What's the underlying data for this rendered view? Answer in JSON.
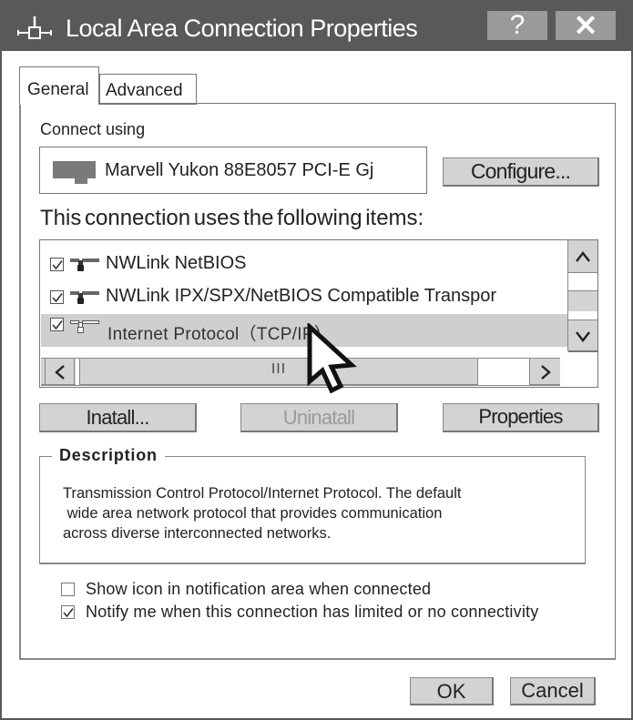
{
  "window": {
    "title": "Local Area Connection Properties",
    "help_label": "?",
    "close_label": "✕",
    "title_icon": "network-connection-icon"
  },
  "tabs": [
    {
      "label": "General",
      "active": true
    },
    {
      "label": "Advanced",
      "active": false
    }
  ],
  "connect_using": {
    "label": "Connect using",
    "adapter_name": "Marvell Yukon 88E8057 PCI-E Gj",
    "adapter_icon": "network-adapter-icon",
    "configure_label": "Configure..."
  },
  "items_section": {
    "heading": "This connection uses the following items:",
    "items": [
      {
        "label": "NWLink NetBIOS",
        "checked": true,
        "selected": false,
        "icon": "protocol-icon"
      },
      {
        "label": "NWLink IPX/SPX/NetBIOS Compatible Transpor",
        "checked": true,
        "selected": false,
        "icon": "protocol-icon"
      },
      {
        "label": "Internet Protocol（TCP/IP）",
        "checked": true,
        "selected": true,
        "icon": "protocol-icon"
      }
    ],
    "scroll_up": "^",
    "scroll_down": "v",
    "scroll_left": "<",
    "scroll_right": ">",
    "hscroll_grip": "III"
  },
  "actions": {
    "install_label": "Inatall...",
    "uninstall_label": "Uninatall",
    "uninstall_disabled": true,
    "properties_label": "Properties"
  },
  "description": {
    "legend": "Description",
    "text": "Transmission Control Protocol/Internet Protocol. The default\n wide area network protocol that provides communication\nacross diverse interconnected networks."
  },
  "options": [
    {
      "label": "Show icon in notification area when connected",
      "checked": false
    },
    {
      "label": "Notify me when this connection has limited or no connectivity",
      "checked": true
    }
  ],
  "footer": {
    "ok_label": "OK",
    "cancel_label": "Cancel"
  },
  "colors": {
    "titlebar": "#595959",
    "button_face": "#d3d3d3",
    "selected_row": "#cfcfcf",
    "disabled_text": "#9a9a9a"
  }
}
